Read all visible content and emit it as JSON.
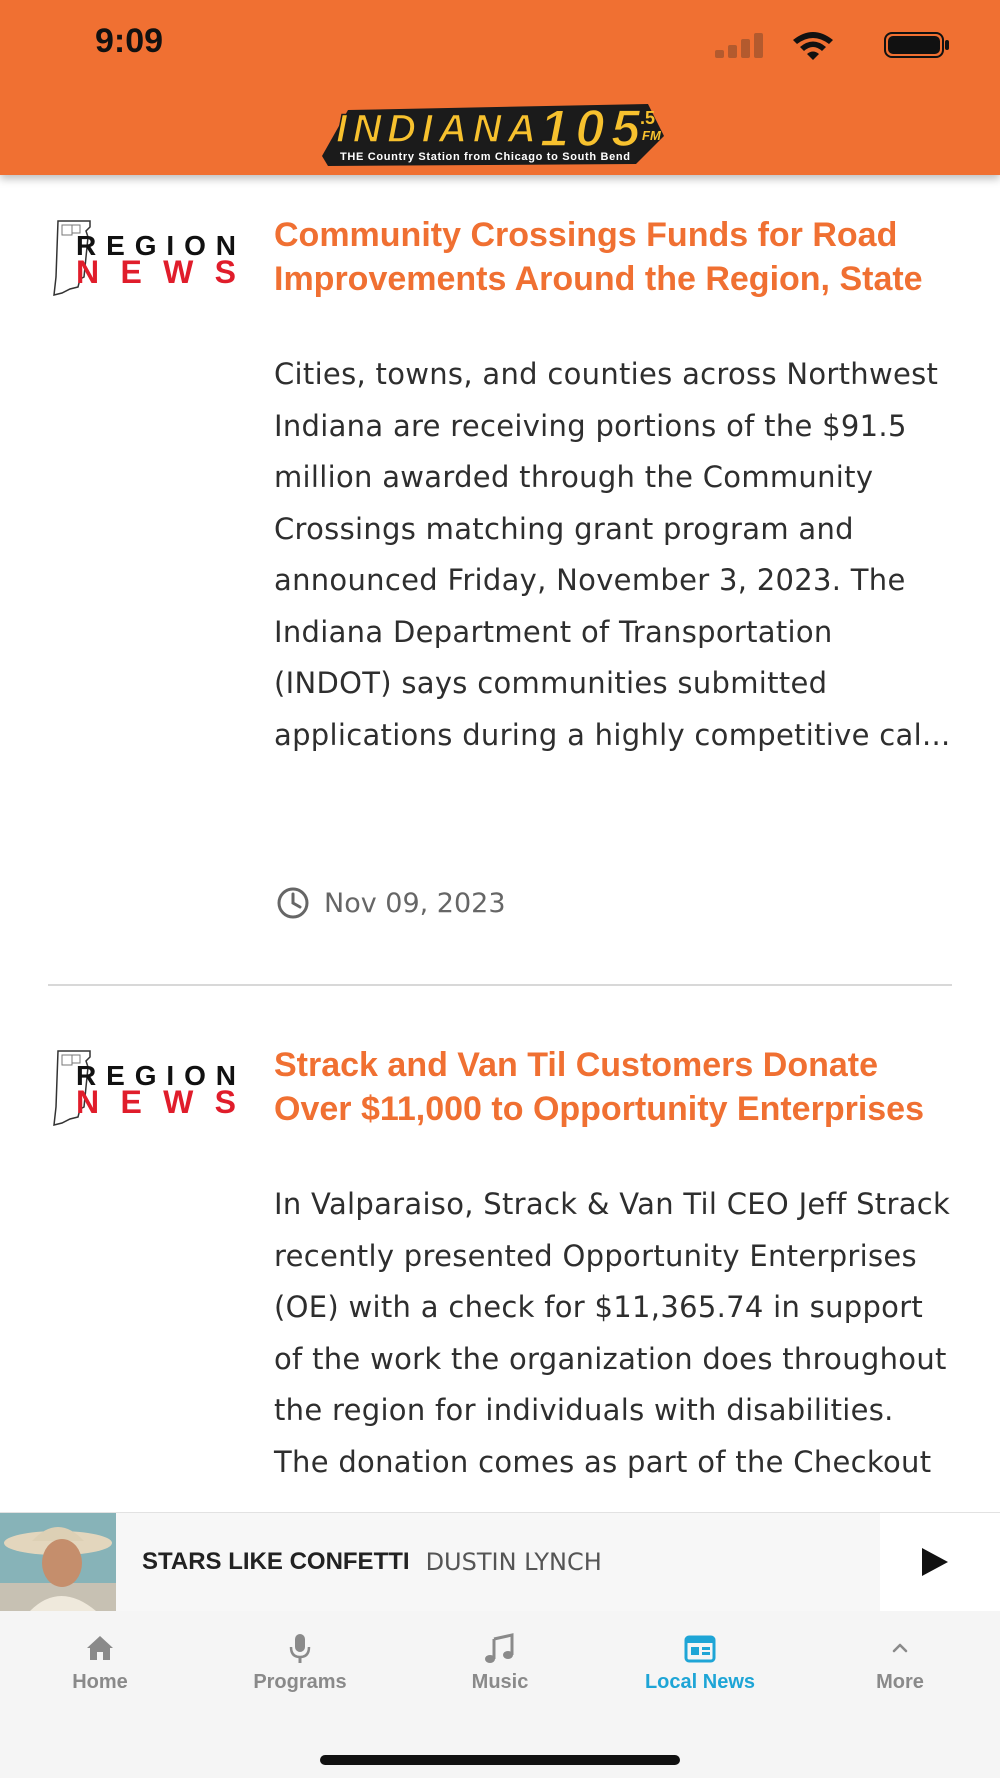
{
  "status_bar": {
    "time": "9:09"
  },
  "header": {
    "logo_text": "INDIANA 105.5 FM",
    "logo_tagline": "THE Country Station from Chicago to South Bend"
  },
  "articles": [
    {
      "source_logo": "REGION NEWS",
      "title": "Community Crossings Funds for Road Improvements Around the Region, State",
      "excerpt": "Cities, towns, and counties across Northwest Indiana are receiving portions of the $91.5 million awarded through the Community Crossings matching grant program and announced Friday, November 3, 2023. The Indiana Department of Transportation (INDOT) says communities submitted applications during a highly competitive cal...",
      "date": "Nov 09, 2023"
    },
    {
      "source_logo": "REGION NEWS",
      "title": "Strack and Van Til Customers Donate Over $11,000 to Opportunity Enterprises",
      "excerpt": "In Valparaiso, Strack & Van Til CEO Jeff Strack recently presented Opportunity Enterprises (OE) with a check for $11,365.74 in support of the work the organization does throughout the region for individuals with disabilities. The donation comes as part of the Checkout"
    }
  ],
  "now_playing": {
    "song": "STARS LIKE CONFETTI",
    "artist": "DUSTIN LYNCH"
  },
  "tabs": [
    {
      "label": "Home",
      "icon": "home-icon"
    },
    {
      "label": "Programs",
      "icon": "microphone-icon"
    },
    {
      "label": "Music",
      "icon": "music-note-icon"
    },
    {
      "label": "Local News",
      "icon": "newspaper-icon",
      "active": true
    },
    {
      "label": "More",
      "icon": "chevron-up-icon"
    }
  ],
  "colors": {
    "brand_orange": "#F07032",
    "active_tab": "#1EA5D6",
    "inactive_tab": "#8A8A8A"
  }
}
